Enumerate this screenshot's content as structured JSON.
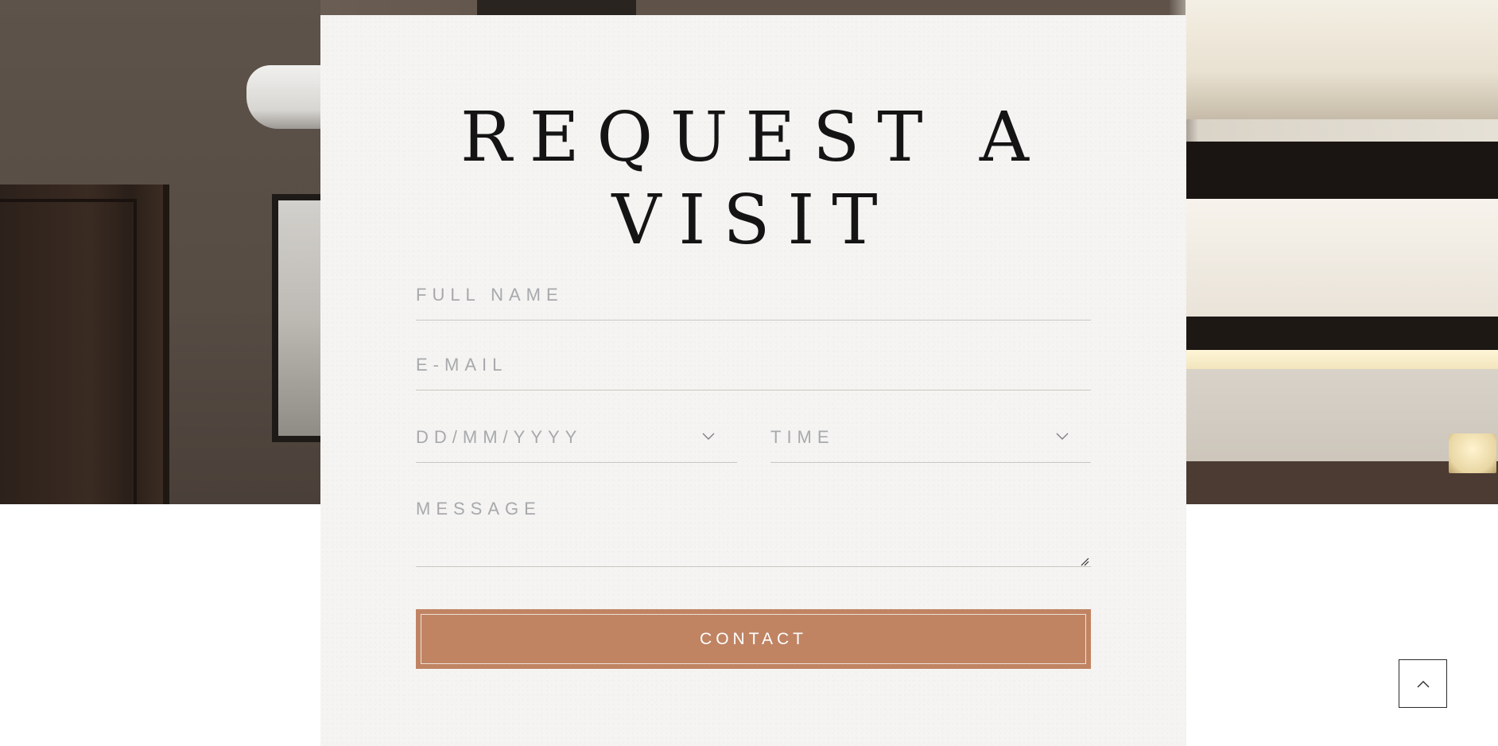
{
  "form": {
    "title_line1": "REQUEST A",
    "title_line2": "VISIT",
    "full_name_placeholder": "FULL NAME",
    "email_placeholder": "E-MAIL",
    "date_placeholder": "DD/MM/YYYY",
    "time_placeholder": "TIME",
    "message_placeholder": "MESSAGE",
    "submit_label": "CONTACT"
  },
  "icons": {
    "dropdown": "chevron-down-icon",
    "resize": "resize-grip-icon",
    "back_to_top": "chevron-up-icon"
  },
  "colors": {
    "button": "#c08463",
    "card_background": "#f5f4f2",
    "placeholder_text": "#a7a9ac",
    "title_text": "#141414"
  }
}
